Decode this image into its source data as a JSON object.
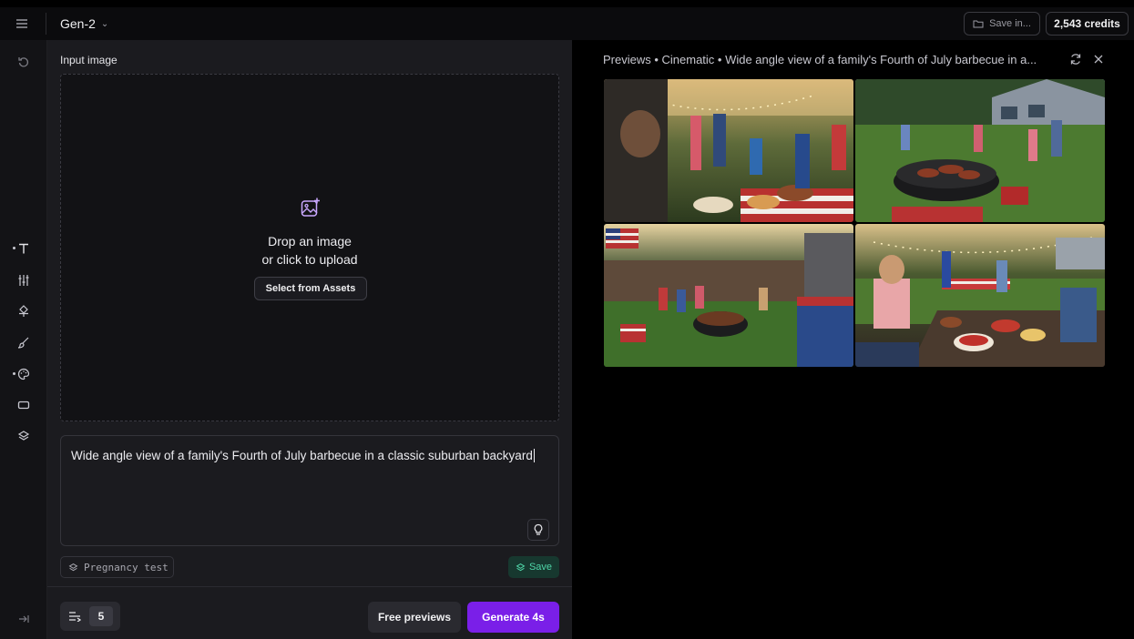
{
  "topbar": {
    "menu_icon": "hamburger-icon",
    "model_name": "Gen-2",
    "model_chevron": "⌄",
    "save_in_label": "Save in...",
    "credits_label": "2,543 credits"
  },
  "rail": {
    "items": [
      {
        "name": "undo",
        "icon": "undo-icon"
      },
      {
        "name": "text",
        "icon": "text-icon",
        "active": true
      },
      {
        "name": "adjust",
        "icon": "sliders-icon"
      },
      {
        "name": "camera",
        "icon": "move-icon"
      },
      {
        "name": "brush",
        "icon": "brush-icon"
      },
      {
        "name": "style",
        "icon": "palette-icon",
        "active": true
      },
      {
        "name": "aspect",
        "icon": "aspect-ratio-icon"
      },
      {
        "name": "presets",
        "icon": "layers-icon"
      },
      {
        "name": "collapse",
        "icon": "collapse-icon"
      }
    ]
  },
  "input": {
    "label": "Input image",
    "drop_line1": "Drop an image",
    "drop_line2": "or click to upload",
    "assets_button": "Select from Assets"
  },
  "prompt": {
    "text": "Wide angle view of a family's Fourth of July barbecue in a classic suburban backyard"
  },
  "preset": {
    "label": "Pregnancy test",
    "save_label": "Save"
  },
  "bottom": {
    "count": "5",
    "free_previews_label": "Free previews",
    "generate_label": "Generate 4s"
  },
  "previews": {
    "title": "Previews • Cinematic • Wide angle view of a family's Fourth of July barbecue in a...",
    "images": [
      {
        "alt": "Family at table under string lights"
      },
      {
        "alt": "Grill in front of a suburban house"
      },
      {
        "alt": "Backyard with flags and grill"
      },
      {
        "alt": "Children at picnic table with food"
      }
    ]
  },
  "colors": {
    "accent": "#7a1fe8",
    "save_green": "#4fd6a8"
  }
}
